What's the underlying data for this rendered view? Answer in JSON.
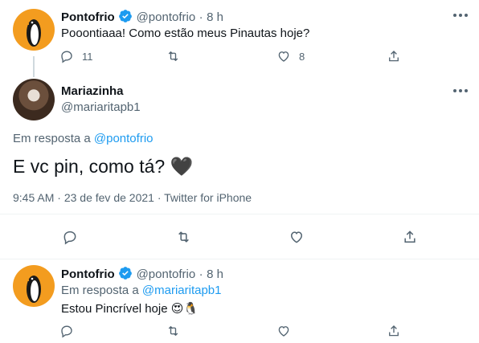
{
  "tweet1": {
    "name": "Pontofrio",
    "handle": "@pontofrio",
    "time": "8 h",
    "separator": "·",
    "text": "Pooontiaaa! Como estão meus Pinautas hoje?",
    "reply_count": "11",
    "like_count": "8"
  },
  "tweet2": {
    "name": "Mariazinha",
    "handle": "@mariaritapb1",
    "reply_prefix": "Em resposta a",
    "reply_to": "@pontofrio",
    "text": "E vc pin, como tá? 🖤",
    "time": "9:45 AM",
    "date": "23 de fev de 2021",
    "separator": "·",
    "source": "Twitter for iPhone"
  },
  "tweet3": {
    "name": "Pontofrio",
    "handle": "@pontofrio",
    "time": "8 h",
    "separator": "·",
    "reply_prefix": "Em resposta a",
    "reply_to": "@mariaritapb1",
    "text": "Estou Pincrível hoje 😍🐧"
  },
  "icons": [
    "avatar",
    "verified-icon",
    "more-icon",
    "reply-icon",
    "retweet-icon",
    "like-icon",
    "share-icon"
  ],
  "colors": {
    "accent": "#1d9bf0",
    "muted": "#536471",
    "brand_orange": "#f39c1f",
    "divider": "#eff3f4"
  }
}
